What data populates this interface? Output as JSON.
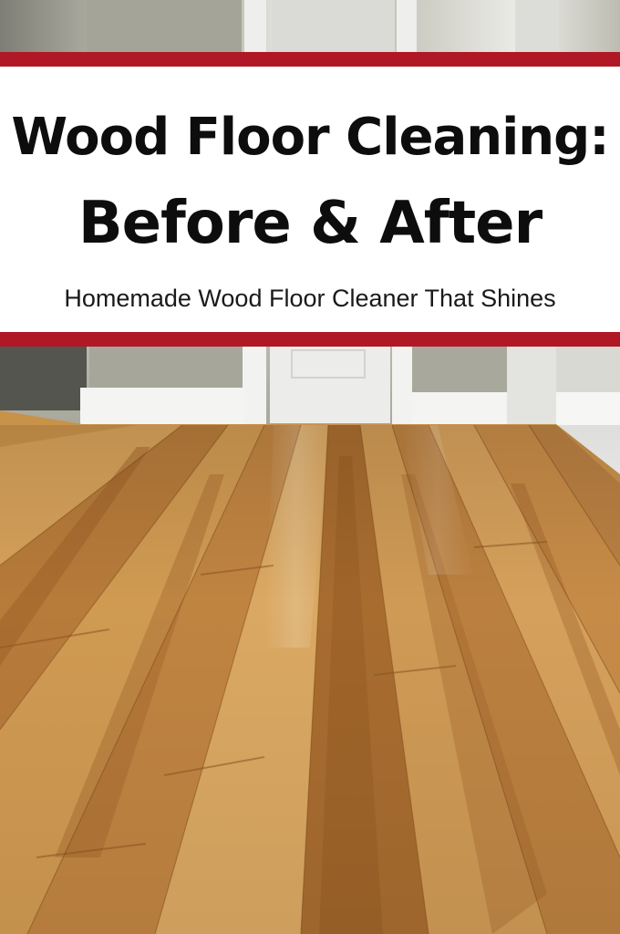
{
  "title": {
    "line1": "Wood Floor Cleaning:",
    "line2": "Before & After"
  },
  "subtitle": "Homemade Wood Floor Cleaner That Shines",
  "colors": {
    "accent_band": "#b11826",
    "title_text": "#0d0d0d",
    "panel_background": "#ffffff",
    "wood_light": "#d8a55a",
    "wood_dark": "#9b5d25"
  }
}
